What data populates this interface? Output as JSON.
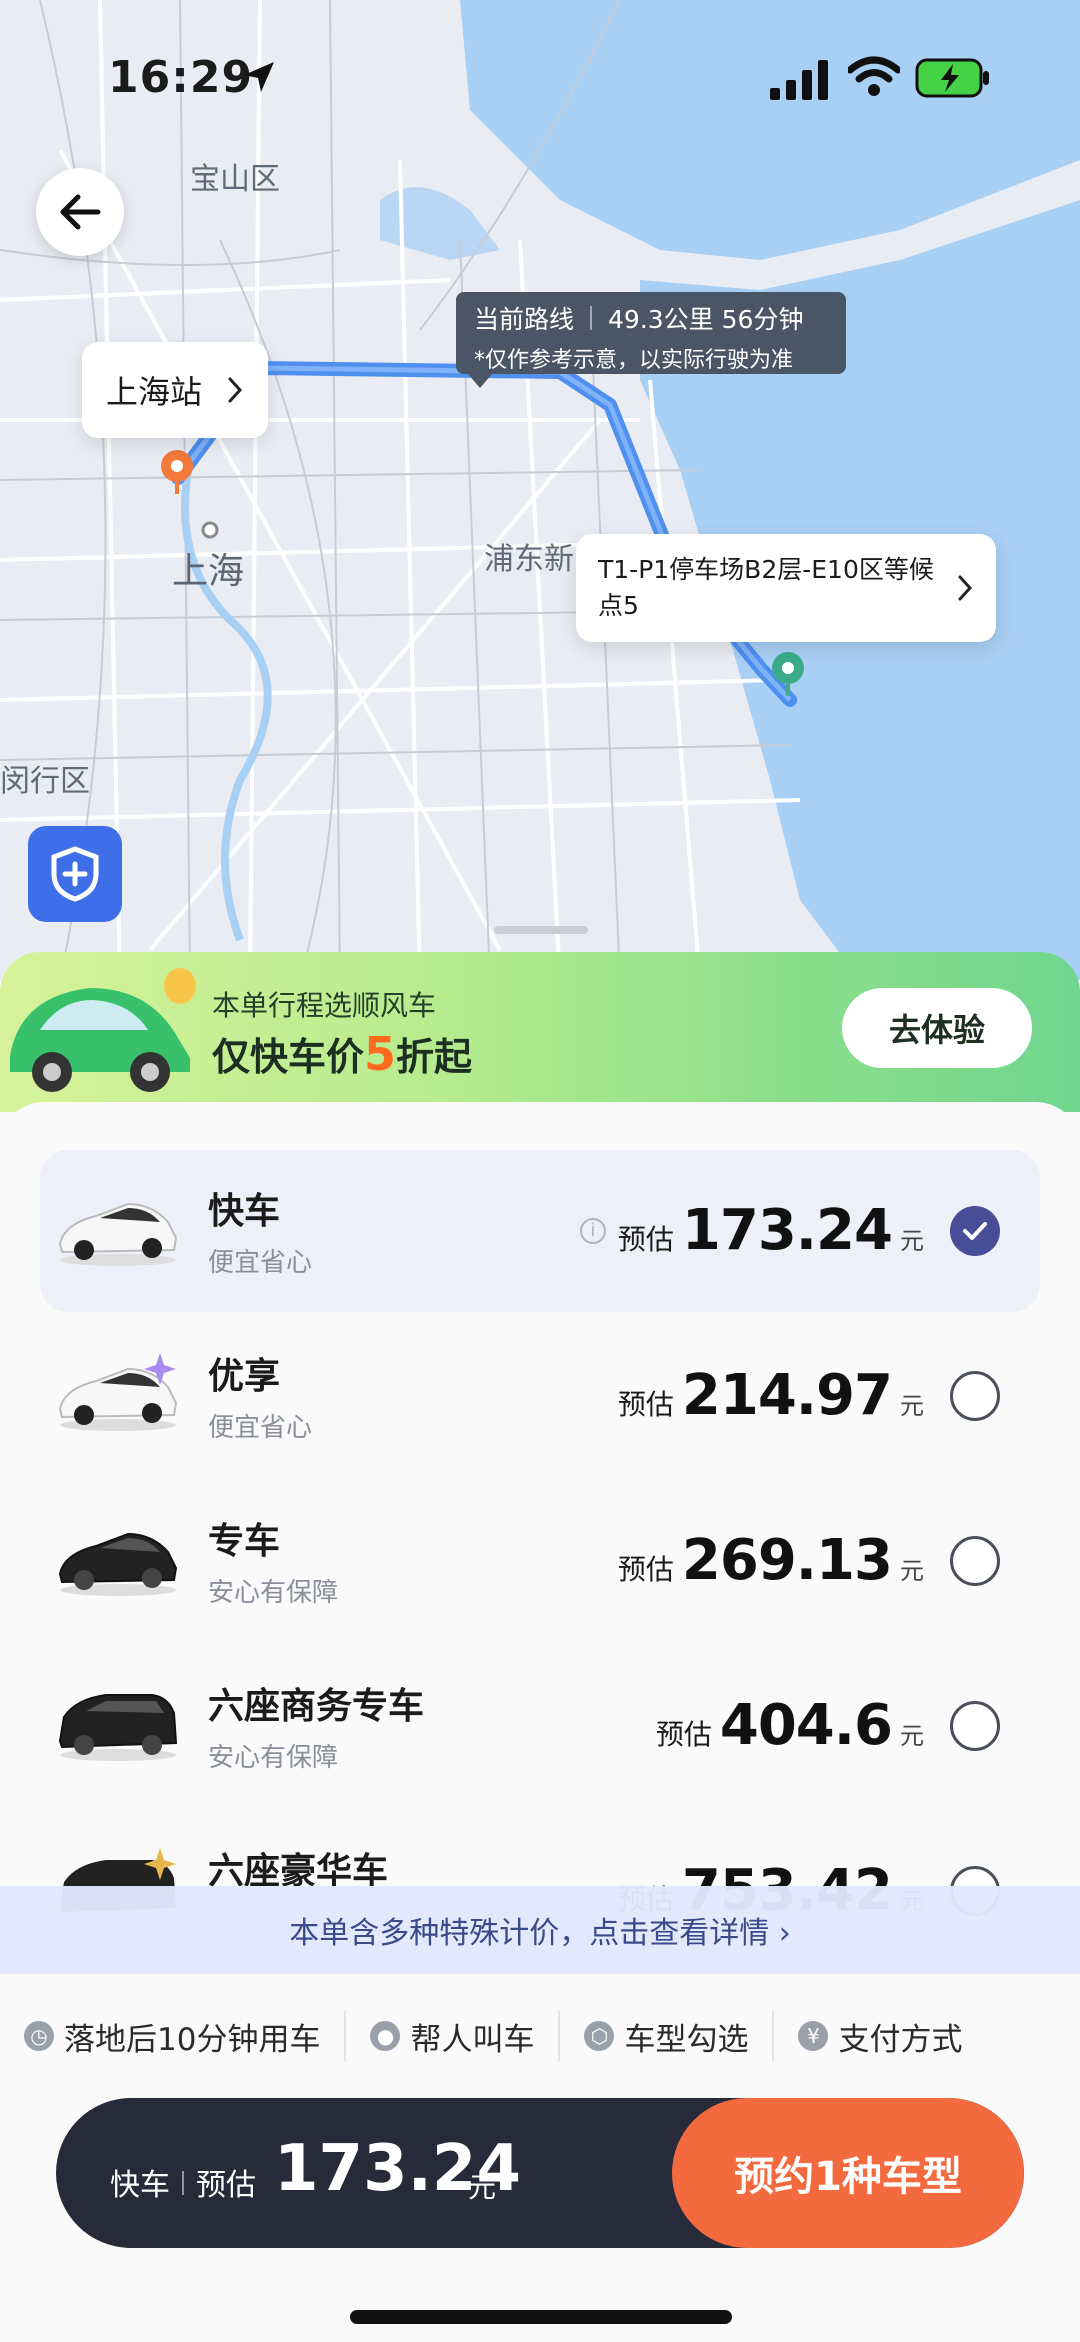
{
  "status_bar": {
    "time": "16:29"
  },
  "map": {
    "labels": {
      "baoshan": "宝山区",
      "shanghai": "上海",
      "pudong": "浦东新",
      "minhang": "闵行区"
    },
    "route_tip": {
      "title": "当前路线",
      "distance": "49.3公里",
      "duration": "56分钟",
      "note": "*仅作参考示意，以实际行驶为准"
    },
    "start_pin": {
      "label": "上海站"
    },
    "end_pin": {
      "label": "T1-P1停车场B2层-E10区等候点5"
    }
  },
  "promo": {
    "line1": "本单行程选顺风车",
    "line2_prefix": "仅快车价",
    "line2_highlight": "5",
    "line2_suffix": "折起",
    "button": "去体验"
  },
  "car_options": [
    {
      "name": "快车",
      "desc": "便宜省心",
      "est_label": "预估",
      "price": "173.24",
      "unit": "元",
      "selected": true
    },
    {
      "name": "优享",
      "desc": "便宜省心",
      "est_label": "预估",
      "price": "214.97",
      "unit": "元",
      "selected": false
    },
    {
      "name": "专车",
      "desc": "安心有保障",
      "est_label": "预估",
      "price": "269.13",
      "unit": "元",
      "selected": false
    },
    {
      "name": "六座商务专车",
      "desc": "安心有保障",
      "est_label": "预估",
      "price": "404.6",
      "unit": "元",
      "selected": false
    },
    {
      "name": "六座豪华车",
      "desc": "",
      "est_label": "预估",
      "price": "753.42",
      "unit": "元",
      "selected": false
    }
  ],
  "notice": "本单含多种特殊计价，点击查看详情 ›",
  "options": [
    "落地后10分钟用车",
    "帮人叫车",
    "车型勾选",
    "支付方式"
  ],
  "bottom_bar": {
    "car_type": "快车",
    "est_label": "预估",
    "price": "173.24",
    "unit": "元",
    "book_button": "预约1种车型"
  },
  "colors": {
    "accent": "#f26a3d",
    "selected_check": "#474d96",
    "route": "#4f8ff0",
    "bar_bg": "#272a39"
  }
}
